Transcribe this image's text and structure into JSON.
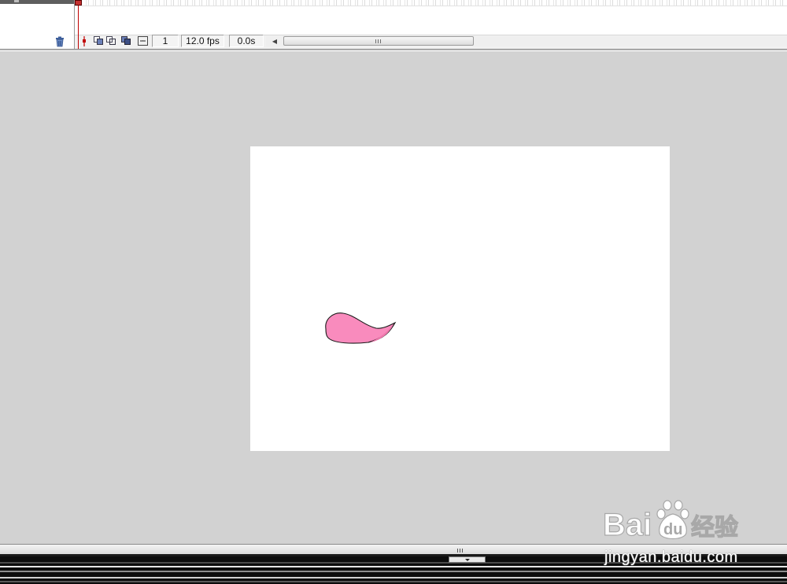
{
  "timeline": {
    "current_frame": "1",
    "frame_rate": "12.0 fps",
    "elapsed_time": "0.0s",
    "playhead_color": "#c00000"
  },
  "stage": {
    "background": "#ffffff",
    "workspace_background": "#d2d2d2"
  },
  "shape": {
    "name": "petal",
    "fill": "#f98bbd",
    "stroke": "#1a1a1a"
  },
  "watermark": {
    "logo_text": "Bai",
    "logo_text_2": "du",
    "logo_cn": "经验",
    "url": "jingyan.baidu.com"
  },
  "icons": {
    "trash": "trash-icon",
    "onion_skin": "onion-skin-icon",
    "onion_skin_outlines": "onion-skin-outlines-icon",
    "edit_multiple_frames": "edit-multiple-frames-icon",
    "modify_onion_markers": "modify-onion-markers-icon",
    "center_frame": "center-frame-icon"
  }
}
